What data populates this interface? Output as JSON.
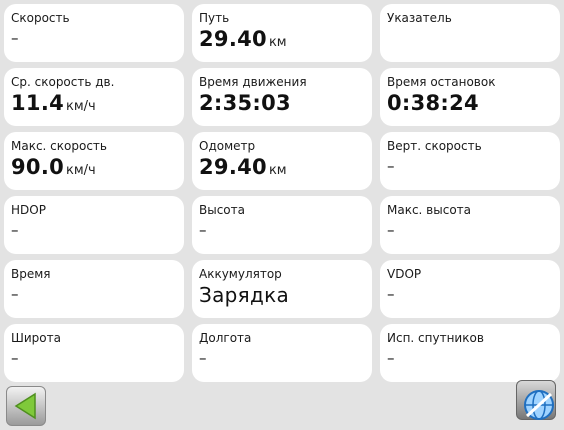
{
  "tiles": [
    {
      "label": "Скорость",
      "value": "–",
      "unit": ""
    },
    {
      "label": "Путь",
      "value": "29.40",
      "unit": "км"
    },
    {
      "label": "Указатель",
      "value": "",
      "unit": ""
    },
    {
      "label": "Ср. скорость дв.",
      "value": "11.4",
      "unit": "км/ч"
    },
    {
      "label": "Время движения",
      "value": "2:35:03",
      "unit": ""
    },
    {
      "label": "Время остановок",
      "value": "0:38:24",
      "unit": ""
    },
    {
      "label": "Макс. скорость",
      "value": "90.0",
      "unit": "км/ч"
    },
    {
      "label": "Одометр",
      "value": "29.40",
      "unit": "км"
    },
    {
      "label": "Верт. скорость",
      "value": "–",
      "unit": ""
    },
    {
      "label": "HDOP",
      "value": "–",
      "unit": ""
    },
    {
      "label": "Высота",
      "value": "–",
      "unit": ""
    },
    {
      "label": "Макс. высота",
      "value": "–",
      "unit": ""
    },
    {
      "label": "Время",
      "value": "–",
      "unit": ""
    },
    {
      "label": "Аккумулятор",
      "value": "Зарядка",
      "unit": ""
    },
    {
      "label": "VDOP",
      "value": "–",
      "unit": ""
    },
    {
      "label": "Широта",
      "value": "–",
      "unit": ""
    },
    {
      "label": "Долгота",
      "value": "–",
      "unit": ""
    },
    {
      "label": "Исп. спутников",
      "value": "–",
      "unit": ""
    }
  ],
  "buttons": {
    "back_icon": "back-arrow-icon",
    "globe_icon": "globe-icon"
  },
  "colors": {
    "background": "#e3e3e3",
    "tile": "#ffffff",
    "back_arrow": "#7fc93a",
    "globe": "#2a8fe0"
  }
}
